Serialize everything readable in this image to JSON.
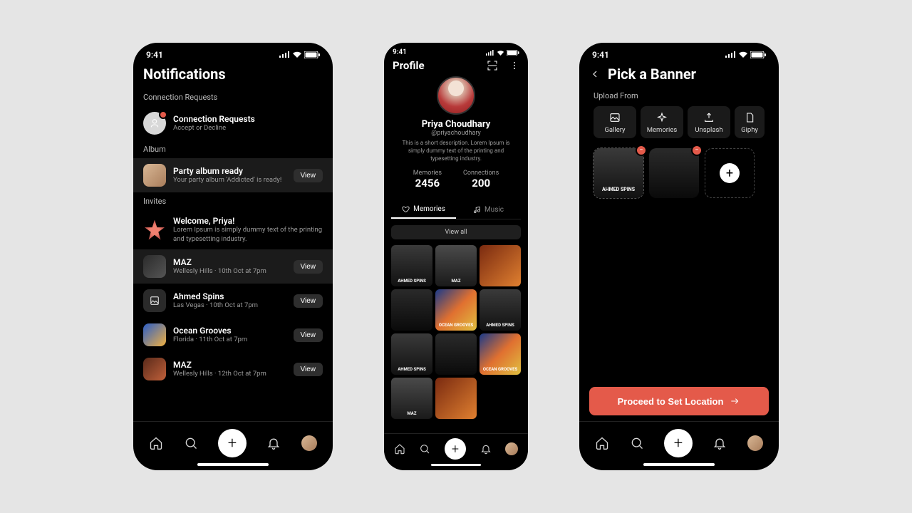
{
  "status": {
    "time": "9:41"
  },
  "screen1": {
    "title": "Notifications",
    "sections": {
      "connection": {
        "label": "Connection Requests",
        "item": {
          "title": "Connection Requests",
          "sub": "Accept or Decline"
        }
      },
      "album": {
        "label": "Album",
        "item": {
          "title": "Party album ready",
          "sub": "Your party album 'Addicted' is ready!",
          "btn": "View"
        }
      },
      "invites": {
        "label": "Invites",
        "items": [
          {
            "title": "Welcome, Priya!",
            "sub": "Lorem Ipsum is simply dummy text of the printing and typesetting industry."
          },
          {
            "title": "MAZ",
            "sub": "Wellesly Hills · 10th Oct at 7pm",
            "btn": "View"
          },
          {
            "title": "Ahmed Spins",
            "sub": "Las Vegas · 10th Oct at 7pm",
            "btn": "View"
          },
          {
            "title": "Ocean Grooves",
            "sub": "Florida · 11th Oct at 7pm",
            "btn": "View"
          },
          {
            "title": "MAZ",
            "sub": "Wellesly Hills · 12th Oct at 7pm",
            "btn": "View"
          }
        ]
      }
    }
  },
  "screen2": {
    "title": "Profile",
    "name": "Priya Choudhary",
    "handle": "@priyachoudhary",
    "bio": "This is a short description. Lorem Ipsum is simply dummy text of the printing and typesetting industry.",
    "stats": {
      "memories": {
        "label": "Memories",
        "value": "2456"
      },
      "connections": {
        "label": "Connections",
        "value": "200"
      }
    },
    "tabs": {
      "memories": "Memories",
      "music": "Music"
    },
    "viewall": "View all",
    "tiles": [
      "AHMED SPINS",
      "MAZ",
      "",
      "",
      "OCEAN GROOVES",
      "AHMED SPINS",
      "AHMED SPINS",
      "",
      "OCEAN GROOVES",
      "MAZ",
      ""
    ]
  },
  "screen3": {
    "title": "Pick a Banner",
    "uploadLabel": "Upload From",
    "sources": [
      "Gallery",
      "Memories",
      "Unsplash",
      "Giphy"
    ],
    "slots": [
      {
        "label": "AHMED SPINS"
      },
      {
        "label": ""
      }
    ],
    "proceed": "Proceed to Set Location"
  }
}
